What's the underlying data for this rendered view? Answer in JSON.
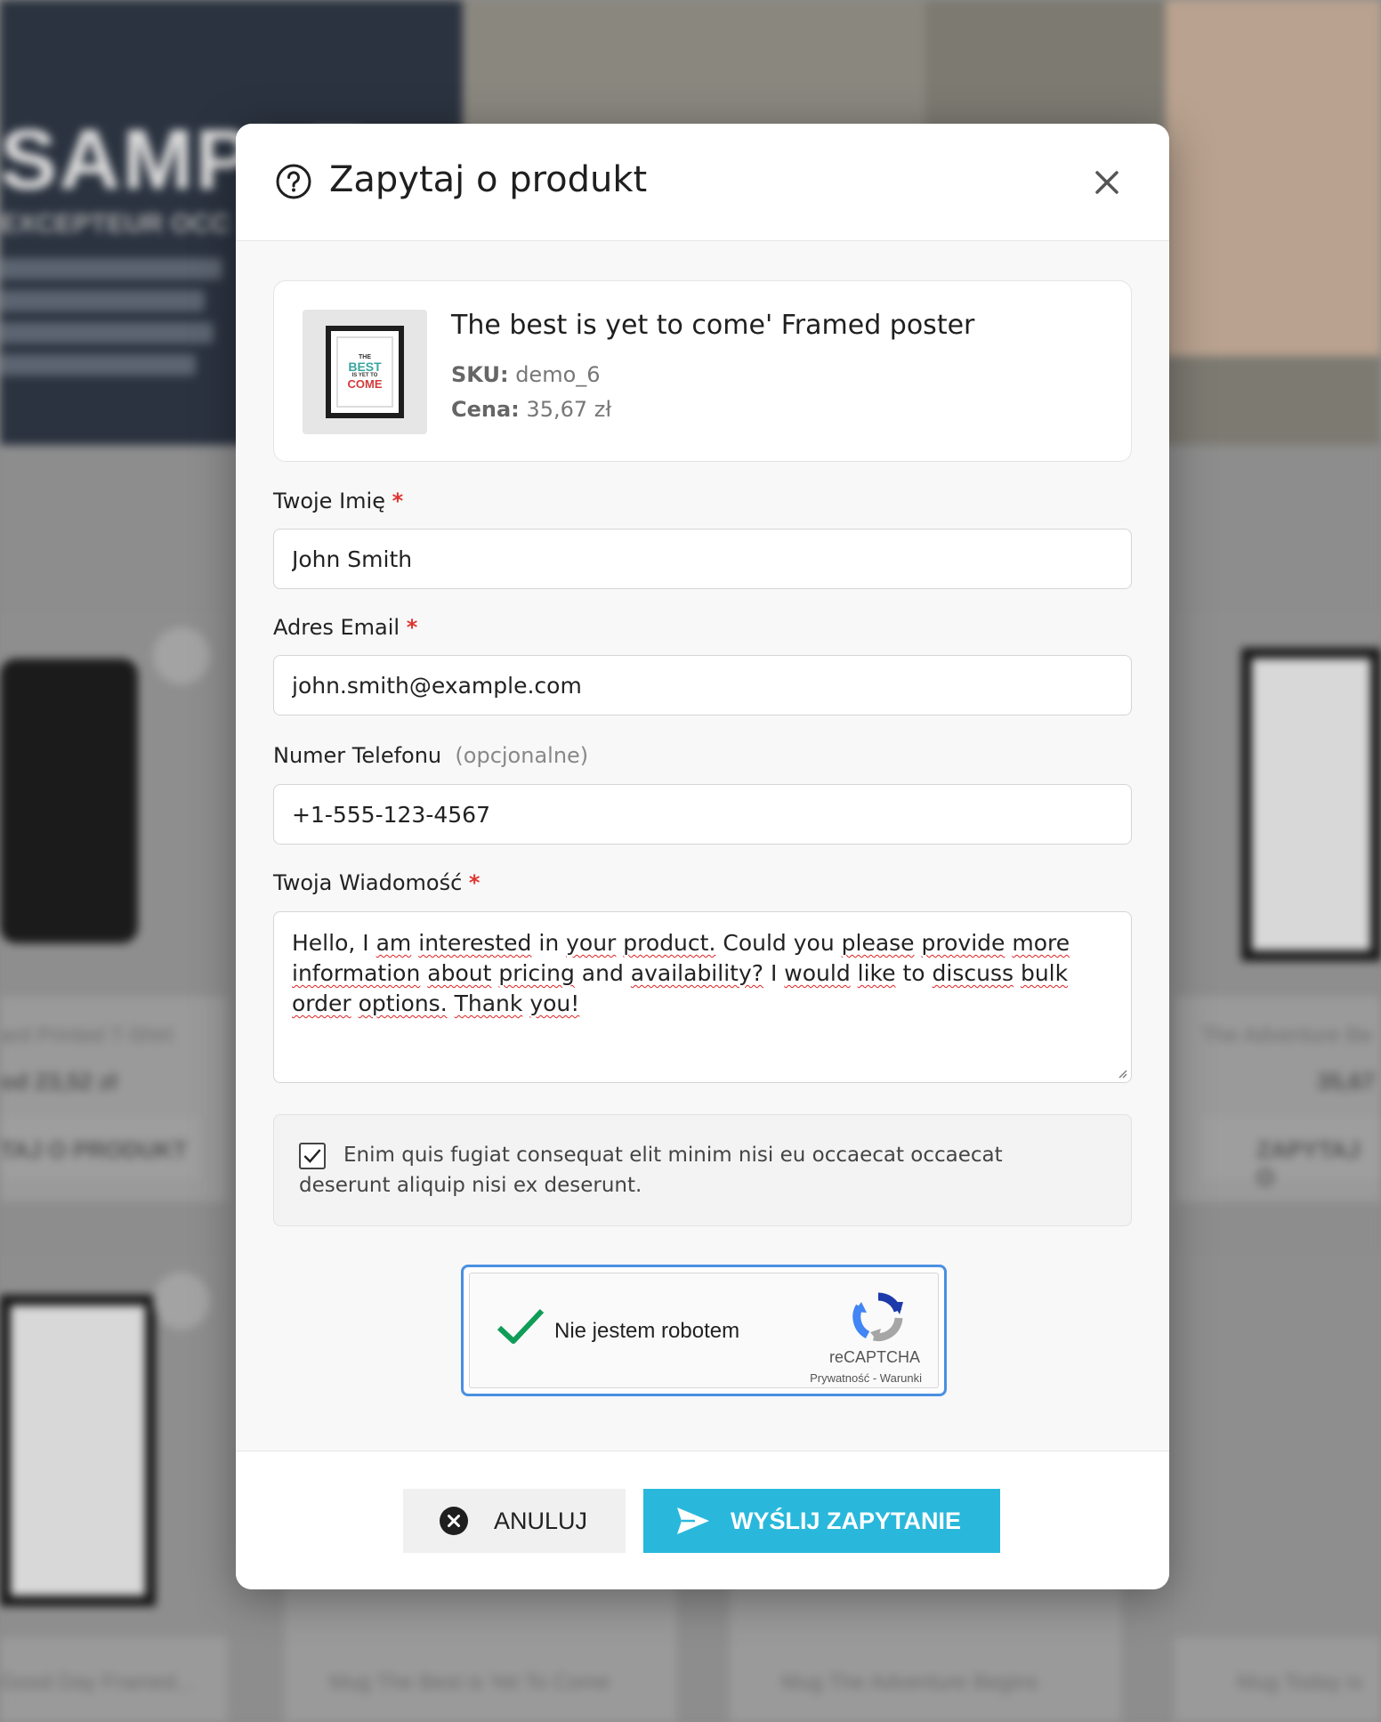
{
  "background": {
    "hero_title": "SAMPLE",
    "hero_subtitle": "EXCEPTEUR OCC",
    "card_labels": [
      "ard Printed T-Shirt",
      "The Adventure Be",
      "Good Day Framed...",
      "Mug The Best is Yet To Come",
      "Mug The Adventure Begins",
      "Mug Today is"
    ],
    "card_prices": [
      "od 23,52 zł",
      "35,67"
    ],
    "card_buttons": [
      "TAJ O PRODUKT",
      "ZAPYTAJ O"
    ]
  },
  "modal": {
    "title": "Zapytaj o produkt",
    "icons": {
      "title_icon": "help-circle-icon",
      "close_icon": "close-icon"
    },
    "product": {
      "name": "The best is yet to come' Framed poster",
      "sku_label": "SKU:",
      "sku_value": "demo_6",
      "price_label": "Cena:",
      "price_value": "35,67 zł",
      "thumb_lines": [
        "THE",
        "BEST",
        "IS YET TO",
        "COME"
      ]
    },
    "fields": {
      "name": {
        "label": "Twoje Imię",
        "required": "*",
        "value": "John Smith"
      },
      "email": {
        "label": "Adres Email",
        "required": "*",
        "value": "john.smith@example.com"
      },
      "phone": {
        "label": "Numer Telefonu",
        "optional": "(opcjonalne)",
        "value": "+1-555-123-4567"
      },
      "message": {
        "label": "Twoja Wiadomość",
        "required": "*",
        "value": "Hello, I am interested in your product. Could you please provide more information about pricing and availability? I would like to discuss bulk order options. Thank you!"
      }
    },
    "consent": {
      "checked": true,
      "text": "Enim quis fugiat consequat elit minim nisi eu occaecat occaecat deserunt aliquip nisi ex deserunt."
    },
    "recaptcha": {
      "label": "Nie jestem robotem",
      "brand": "reCAPTCHA",
      "links": "Prywatność - Warunki",
      "checked": true
    },
    "footer": {
      "cancel_label": "ANULUJ",
      "submit_label": "WYŚLIJ ZAPYTANIE"
    },
    "colors": {
      "accent": "#29b8db",
      "required": "#e0342f",
      "recaptcha_border": "#4a90e2",
      "check_green": "#109d58"
    }
  }
}
